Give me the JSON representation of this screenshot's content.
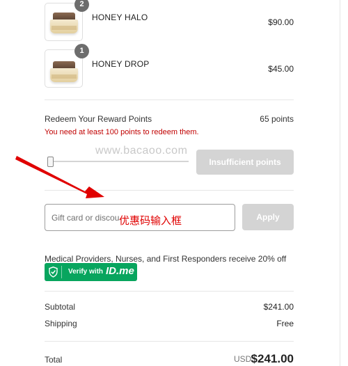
{
  "cart": {
    "items": [
      {
        "name": "HONEY HALO",
        "price": "$90.00",
        "quantity": "2"
      },
      {
        "name": "HONEY DROP",
        "price": "$45.00",
        "quantity": "1"
      }
    ]
  },
  "rewards": {
    "label": "Redeem Your Reward Points",
    "points": "65 points",
    "warning": "You need at least 100 points to redeem them.",
    "slider_value": 0,
    "button_label": "Insufficient points"
  },
  "watermark": "www.bacaoo.com",
  "discount": {
    "placeholder": "Gift card or discount code",
    "visible_placeholder": "Gift card or discou",
    "apply_label": "Apply",
    "annotation": "优惠码输入框"
  },
  "medical": {
    "text": "Medical Providers, Nurses, and First Responders receive 20% off",
    "verify_text": "Verify with",
    "verify_brand": "ID.me"
  },
  "summary": {
    "subtotal_label": "Subtotal",
    "subtotal_value": "$241.00",
    "shipping_label": "Shipping",
    "shipping_value": "Free",
    "total_label": "Total",
    "currency": "USD",
    "total_value": "$241.00"
  },
  "colors": {
    "warning": "#c00000",
    "disabled_button": "#d4d4d4",
    "idme_green": "#08a55e",
    "annotation_red": "#e00000"
  }
}
